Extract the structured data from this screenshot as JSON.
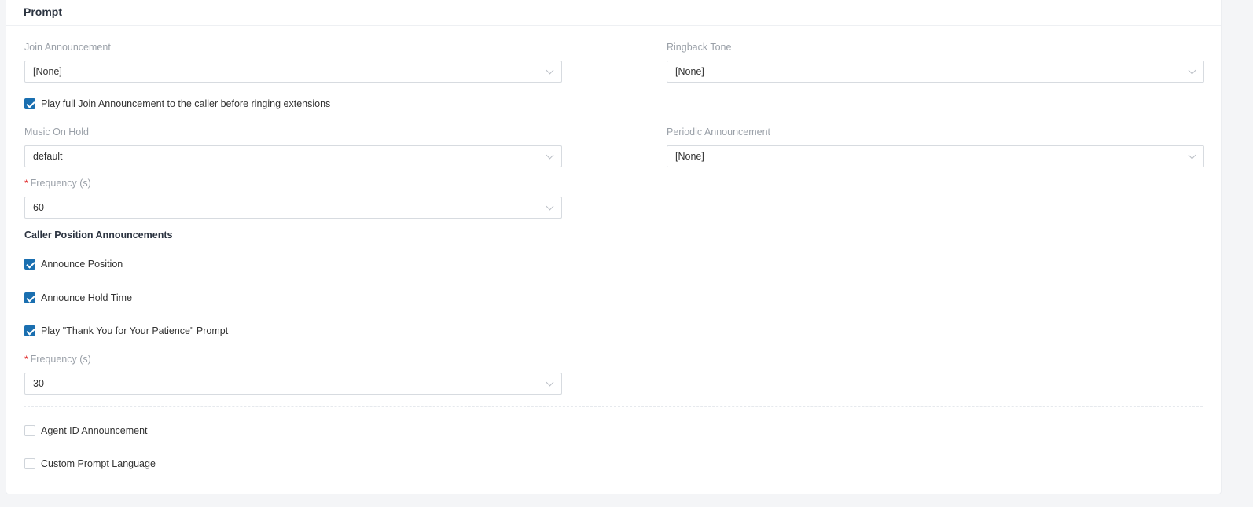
{
  "panel": {
    "title": "Prompt"
  },
  "join_announcement": {
    "label": "Join Announcement",
    "value": "[None]"
  },
  "ringback_tone": {
    "label": "Ringback Tone",
    "value": "[None]"
  },
  "play_full_join": {
    "label": "Play full Join Announcement to the caller before ringing extensions",
    "checked": true
  },
  "music_on_hold": {
    "label": "Music On Hold",
    "value": "default"
  },
  "periodic_announcement": {
    "label": "Periodic Announcement",
    "value": "[None]"
  },
  "frequency_1": {
    "required_mark": "*",
    "label": "Frequency (s)",
    "value": "60"
  },
  "caller_position": {
    "title": "Caller Position Announcements",
    "announce_position": {
      "label": "Announce Position",
      "checked": true
    },
    "announce_hold_time": {
      "label": "Announce Hold Time",
      "checked": true
    },
    "play_thank_you": {
      "label": "Play \"Thank You for Your Patience\" Prompt",
      "checked": true
    }
  },
  "frequency_2": {
    "required_mark": "*",
    "label": "Frequency (s)",
    "value": "30"
  },
  "agent_id_announcement": {
    "label": "Agent ID Announcement",
    "checked": false
  },
  "custom_prompt_language": {
    "label": "Custom Prompt Language",
    "checked": false
  },
  "colors": {
    "accent": "#1a6fb0",
    "required": "#e02424",
    "label_gray": "#9aa0a8"
  }
}
